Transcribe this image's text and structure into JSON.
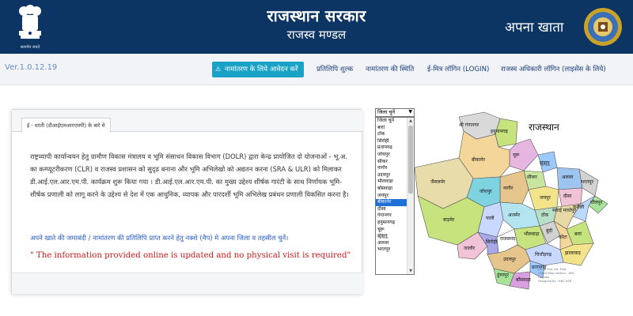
{
  "header": {
    "emblem_caption": "सत्यमेव जयते",
    "title": "राजस्थान सरकार",
    "subtitle": "राजस्व मण्डल",
    "app_name": "अपना खाता",
    "colors": {
      "header_bg": "#0d3563",
      "accent": "#17a2c6",
      "notice": "#d01818"
    }
  },
  "nav": {
    "version": "Ver.1.0.12.19",
    "items": [
      {
        "label": "नामांतरण के लिये आवेदन करें",
        "active": true,
        "icon": "warning-icon"
      },
      {
        "label": "प्रतिलिपि शुल्क"
      },
      {
        "label": "नामांतरण की स्थिति"
      },
      {
        "label": "ई-मित्र लॉगिन (LOGIN)"
      },
      {
        "label": "राजस्व अधिकारी लॉगिन (लाइसेंस के लिये)"
      }
    ]
  },
  "info": {
    "tab_label": "ई - धरती (डीआईएलआरएमपी) के बारे मे",
    "description": "राष्ट्रव्यापी कार्यान्वयन हेतु ग्रामीण विकास मंत्रालय व भूमि संसाधन विकास विभाग (DOLR) द्वारा केन्द्र प्रायोजित दो योजनाओं - भू.अ. का कम्प्यूटरीकरण (CLR) व राजस्व प्रशासन को सुदृढ बनाना और भूमि अभिलेखो को अद्यतन करना (SRA & ULR) को मिलाकर डी.आई.एल.आर.एम.पी. कार्यक्रम शुरू किया गया । डी.आई.एल.आर.एम.पी. का मुख्य उद्देश्य शीर्षक गारंटी के साथ निर्णायक भूमि-शीर्षक प्रणाली को लागू करने के उद्देश्य से देश में एक आधुनिक, व्यापक और पारदर्शी भूमि अभिलेख प्रबंधन प्रणाली विकसित करना है।",
    "instruction": "अपने खाते की जमाबंदी / नामांतरण की प्रतिलिपि प्राप्त करने हेतु नक्शे (मैप) मे अपना जिला व तहसील चुनें।",
    "notice": "\" The information provided online is updated and no physical visit is required\""
  },
  "district_select": {
    "selected_label": "जिला चुनें",
    "options": [
      "जिला चुनें",
      "बारां",
      "टोंक",
      "सिरोही",
      "प्रतापगढ़",
      "जोधपुर",
      "सीकर",
      "नागौर",
      "उदयपुर",
      "भीलवाड़ा",
      "बाँसवाड़ा",
      "जयपुर",
      "बीकानेर",
      "दौसा",
      "गंगानगर",
      "हनुमानगढ़",
      "चूरू",
      "झुंझुनू",
      "अलवर",
      "भरतपुर"
    ],
    "highlighted": "बीकानेर"
  },
  "map": {
    "title": "राजस्थान",
    "credit": [
      "Jaipur Fort Ltd. Estd.",
      "Digital Map Section - DRC Division",
      "Designed By : RNC KSR"
    ],
    "districts": [
      {
        "name": "श्री गंगानगर",
        "fill": "#d9d9d9"
      },
      {
        "name": "हनुमानगढ़",
        "fill": "#c6e37e"
      },
      {
        "name": "चूरू",
        "fill": "#e6b6e0"
      },
      {
        "name": "बीकानेर",
        "fill": "#f4d59a"
      },
      {
        "name": "झुंझुनू",
        "fill": "#9ec9ff"
      },
      {
        "name": "सीकर",
        "fill": "#c8e6a0"
      },
      {
        "name": "नागौर",
        "fill": "#e6c58d"
      },
      {
        "name": "जैसलमेर",
        "fill": "#e9dcab"
      },
      {
        "name": "जोधपुर",
        "fill": "#7fd3e0"
      },
      {
        "name": "जयपुर",
        "fill": "#f3e38a"
      },
      {
        "name": "अलवर",
        "fill": "#9ec5f0"
      },
      {
        "name": "भरतपुर",
        "fill": "#d2d2d2"
      },
      {
        "name": "धौलपुर",
        "fill": "#a8e39a"
      },
      {
        "name": "दौसा",
        "fill": "#f1c3d6"
      },
      {
        "name": "करौली",
        "fill": "#bcd8ff"
      },
      {
        "name": "सवाई माधोपुर",
        "fill": "#e6d9a6"
      },
      {
        "name": "टोंक",
        "fill": "#b8e0c8"
      },
      {
        "name": "अजमेर",
        "fill": "#b4e4f0"
      },
      {
        "name": "पाली",
        "fill": "#c8d8ff"
      },
      {
        "name": "बाड़मेर",
        "fill": "#c6e37e"
      },
      {
        "name": "जालौर",
        "fill": "#f1c3d6"
      },
      {
        "name": "सिरोही",
        "fill": "#a8a8e8"
      },
      {
        "name": "राजसमंद",
        "fill": "#ffffff"
      },
      {
        "name": "भीलवाड़ा",
        "fill": "#c6e37e"
      },
      {
        "name": "बूंदी",
        "fill": "#d2d2d2"
      },
      {
        "name": "कोटा",
        "fill": "#f4d59a"
      },
      {
        "name": "बारां",
        "fill": "#c6e37e"
      },
      {
        "name": "झालावाड़",
        "fill": "#f3e38a"
      },
      {
        "name": "चित्तौड़गढ़",
        "fill": "#c8d8ff"
      },
      {
        "name": "उदयपुर",
        "fill": "#e6c58d"
      },
      {
        "name": "डूंगरपुर",
        "fill": "#a8e39a"
      },
      {
        "name": "बाँसवाड़ा",
        "fill": "#d8a0e0"
      },
      {
        "name": "प्रतापगढ़",
        "fill": "#9ec9ff"
      }
    ]
  }
}
